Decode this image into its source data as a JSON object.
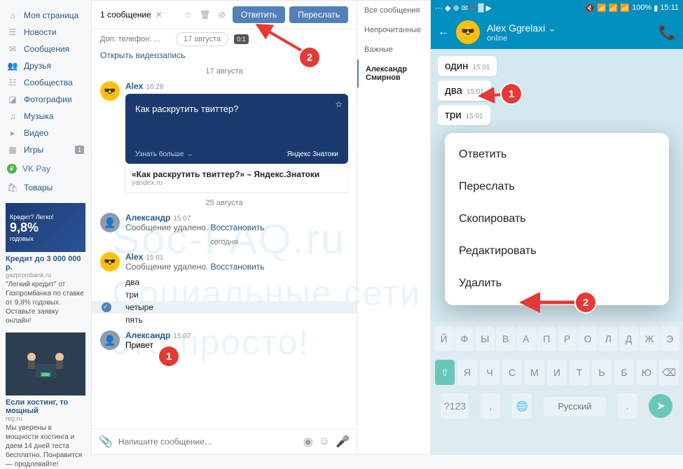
{
  "nav": {
    "items": [
      {
        "label": "Моя страница",
        "icon": "home"
      },
      {
        "label": "Новости",
        "icon": "news"
      },
      {
        "label": "Сообщения",
        "icon": "msg"
      },
      {
        "label": "Друзья",
        "icon": "friends"
      },
      {
        "label": "Сообщества",
        "icon": "groups"
      },
      {
        "label": "Фотографии",
        "icon": "photo"
      },
      {
        "label": "Музыка",
        "icon": "music"
      },
      {
        "label": "Видео",
        "icon": "video"
      },
      {
        "label": "Игры",
        "icon": "games",
        "badge": "1"
      }
    ],
    "vkpay": "VK Pay",
    "market": "Товары"
  },
  "ads": {
    "a1": {
      "pre": "Кредит? Легко!",
      "big": "9,8%",
      "suf": "годовых",
      "title": "Кредит до 3 000 000 р.",
      "domain": "gazprombank.ru",
      "text": "\"Легкий кредит\" от Газпромбанка по ставке от 9,8% годовых. Оставьте заявку онлайн!"
    },
    "a2": {
      "title": "Если хостинг, то мощный",
      "domain": "reg.ru",
      "text": "Мы уверены в мощности хостинга и даем 14 дней теста бесплатно. Понравится — продлевайте!",
      "ssd": "SSD"
    }
  },
  "selbar": {
    "count": "1 сообщение",
    "reply": "Ответить",
    "forward": "Переслать"
  },
  "dates": {
    "d1": "17 августа",
    "d1chip": "17 августа",
    "d2": "25 августа",
    "d3": "сегодня"
  },
  "phone_placeholder": "Доп. телефон: ...",
  "video_link": "Открыть видеозапись",
  "msgs": {
    "alex": {
      "name": "Alex",
      "time": "16:28"
    },
    "card_q": "Как раскрутить твиттер?",
    "card_more": "Узнать больше →",
    "card_brand": "Яндекс Знатоки",
    "link_title": "«Как раскрутить твиттер?» – Яндекс.Знатоки",
    "link_domain": "yandex.ru",
    "alexander": {
      "name": "Александр",
      "time": "15:07"
    },
    "deleted": "Сообщение удалено.",
    "restore": "Восстановить",
    "alex2": {
      "name": "Alex",
      "time": "15:01"
    },
    "m": {
      "dva": "два",
      "tri": "три",
      "chetyre": "четыре",
      "pyat": "пять",
      "privet": "Привет"
    },
    "alexander2": {
      "name": "Александр",
      "time": "15:07"
    }
  },
  "compose": {
    "placeholder": "Напишите сообщение..."
  },
  "filters": {
    "all": "Все сообщения",
    "unread": "Непрочитанные",
    "important": "Важные",
    "person": "Александр Смирнов"
  },
  "phone": {
    "status": {
      "battery": "100%",
      "time": "15:11"
    },
    "contact": {
      "name": "Alex Ggrelaxi",
      "status": "online"
    },
    "bubbles": [
      {
        "t": "один",
        "time": "15:01"
      },
      {
        "t": "два",
        "time": "15:01"
      },
      {
        "t": "три",
        "time": "15:01"
      }
    ],
    "menu": {
      "reply": "Ответить",
      "forward": "Переслать",
      "copy": "Скопировать",
      "edit": "Редактировать",
      "delete": "Удалить"
    },
    "kbd": {
      "r1": [
        "Й",
        "Ф",
        "Ы",
        "В",
        "А",
        "П",
        "Р",
        "О",
        "Л",
        "Д",
        "Ж",
        "Э"
      ],
      "r2": [
        "Я",
        "Ч",
        "С",
        "М",
        "И",
        "Т",
        "Ь",
        "Б",
        "Ю"
      ],
      "numkey": "?123",
      "lang": "Русский",
      "comma": ",",
      "dot": "."
    }
  },
  "markers": {
    "one": "1",
    "two": "2"
  },
  "watermark": {
    "l1": "Soc-FAQ.ru",
    "l2": "Социальные сети",
    "l3": "это просто!"
  }
}
